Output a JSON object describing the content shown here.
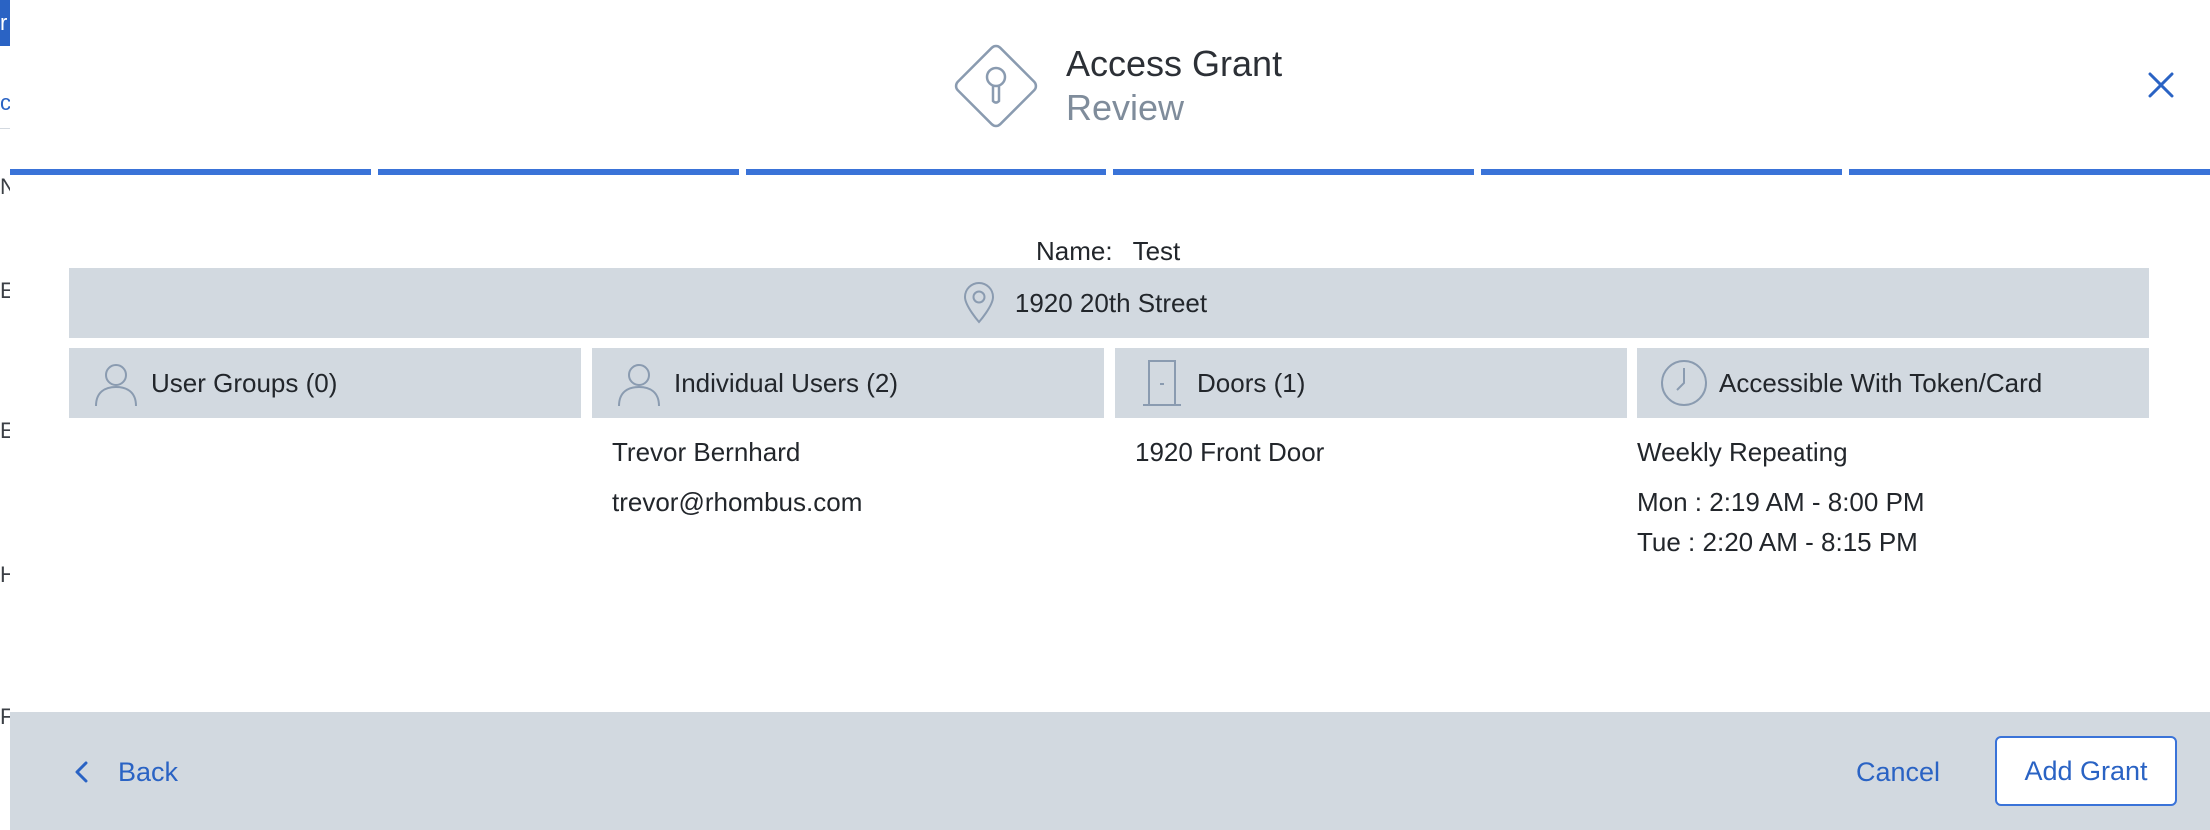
{
  "background": {
    "letters": [
      "r",
      "c",
      "N",
      "E",
      "E",
      "H",
      "F"
    ]
  },
  "header": {
    "title": "Access Grant",
    "subtitle": "Review",
    "icon": "keyhole-diamond-icon",
    "close_icon": "close-icon"
  },
  "progress": {
    "steps_completed": 6,
    "steps_total": 6
  },
  "review": {
    "name_label": "Name:",
    "name_value": "Test",
    "location": "1920 20th Street",
    "cards": {
      "user_groups": {
        "label": "User Groups (0)",
        "icon": "user-icon"
      },
      "individual_users": {
        "label": "Individual Users (2)",
        "icon": "user-icon"
      },
      "doors": {
        "label": "Doors (1)",
        "icon": "door-icon"
      },
      "schedule": {
        "label": "Accessible With Token/Card",
        "icon": "clock-icon"
      }
    },
    "users": [
      "Trevor Bernhard",
      "trevor@rhombus.com"
    ],
    "doors": [
      "1920 Front Door"
    ],
    "schedule": {
      "type": "Weekly Repeating",
      "entries": [
        "Mon : 2:19 AM - 8:00 PM",
        "Tue : 2:20 AM - 8:15 PM"
      ]
    }
  },
  "footer": {
    "back_label": "Back",
    "cancel_label": "Cancel",
    "add_label": "Add Grant"
  },
  "colors": {
    "accent": "#2a63c4",
    "progress": "#3a73d8",
    "panel": "#d2d9e0"
  }
}
